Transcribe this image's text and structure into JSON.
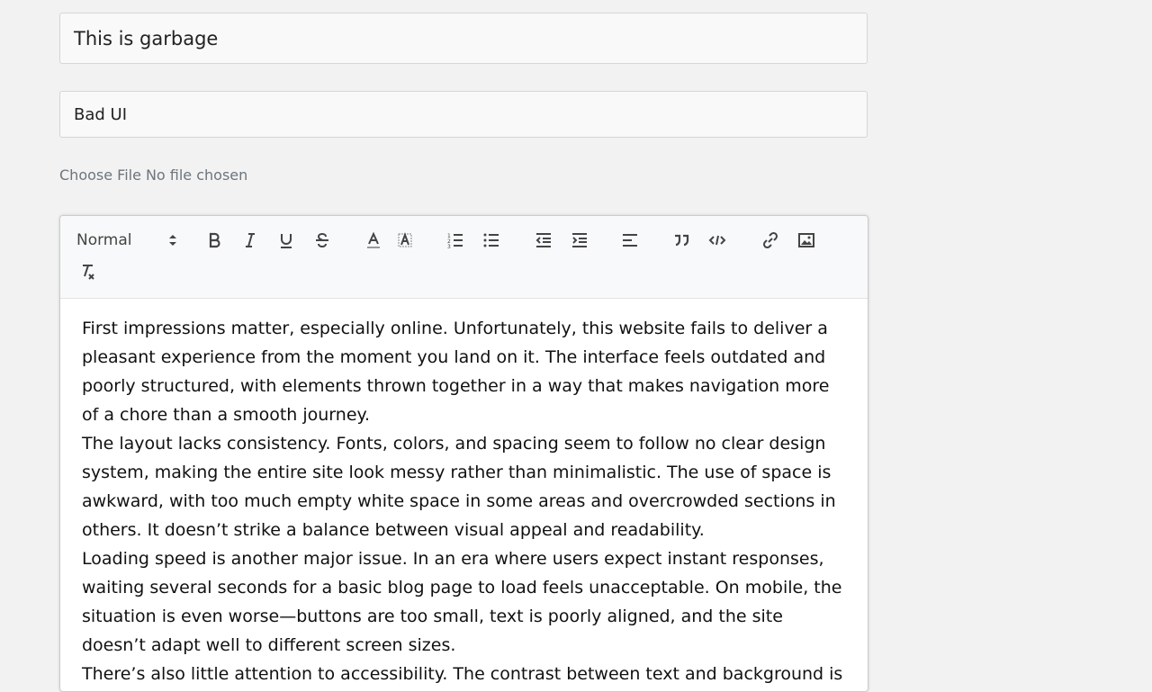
{
  "form": {
    "title_value": "This is garbage",
    "tags_value": "Bad UI",
    "file_button": "Choose File",
    "file_status": "No file chosen"
  },
  "editor": {
    "header_select": "Normal",
    "toolbar_icons": [
      "bold-icon",
      "italic-icon",
      "underline-icon",
      "strike-icon",
      "font-color-icon",
      "background-color-icon",
      "ordered-list-icon",
      "bullet-list-icon",
      "outdent-icon",
      "indent-icon",
      "align-icon",
      "blockquote-icon",
      "code-block-icon",
      "link-icon",
      "image-icon",
      "clear-format-icon"
    ],
    "paragraphs": [
      "First impressions matter, especially online. Unfortunately, this website fails to deliver a pleasant experience from the moment you land on it. The interface feels outdated and poorly structured, with elements thrown together in a way that makes navigation more of a chore than a smooth journey.",
      "The layout lacks consistency. Fonts, colors, and spacing seem to follow no clear design system, making the entire site look messy rather than minimalistic. The use of space is awkward, with too much empty white space in some areas and overcrowded sections in others. It doesn’t strike a balance between visual appeal and readability.",
      "Loading speed is another major issue. In an era where users expect instant responses, waiting several seconds for a basic blog page to load feels unacceptable. On mobile, the situation is even worse—buttons are too small, text is poorly aligned, and the site doesn’t adapt well to different screen sizes.",
      "There’s also little attention to accessibility. The contrast between text and background is weak in"
    ]
  }
}
